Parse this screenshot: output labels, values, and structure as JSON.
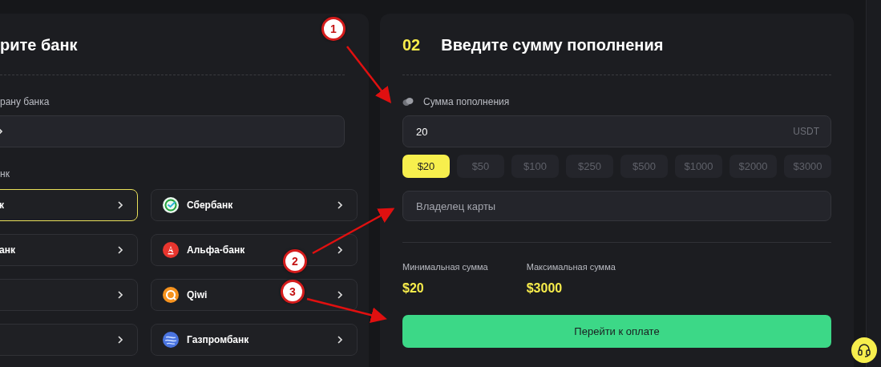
{
  "bank_panel": {
    "title": "рите банк",
    "country_label": "рану банка",
    "bank_label": "нк",
    "banks_column_1": [
      {
        "name": "к",
        "selected": true
      },
      {
        "name": "анк",
        "selected": false
      },
      {
        "selected": false
      },
      {
        "selected": false
      }
    ],
    "banks_column_2": [
      {
        "name": "Сбербанк",
        "kind": "sber",
        "selected": false
      },
      {
        "name": "Альфа-банк",
        "kind": "alfa",
        "selected": false
      },
      {
        "name": "Qiwi",
        "kind": "qiwi",
        "selected": false
      },
      {
        "name": "Газпромбанк",
        "kind": "gazprom",
        "selected": false
      }
    ]
  },
  "amount_panel": {
    "step": "02",
    "title": "Введите сумму пополнения",
    "amount_label": "Сумма пополнения",
    "amount_value": "20",
    "currency": "USDT",
    "presets": [
      {
        "label": "$20",
        "selected": true
      },
      {
        "label": "$50",
        "selected": false
      },
      {
        "label": "$100",
        "selected": false
      },
      {
        "label": "$250",
        "selected": false
      },
      {
        "label": "$500",
        "selected": false
      },
      {
        "label": "$1000",
        "selected": false
      },
      {
        "label": "$2000",
        "selected": false
      },
      {
        "label": "$3000",
        "selected": false
      }
    ],
    "owner_placeholder": "Владелец карты",
    "limits": [
      {
        "label": "Минимальная сумма",
        "value": "$20"
      },
      {
        "label": "Максимальная сумма",
        "value": "$3000"
      }
    ],
    "pay_button": "Перейти к оплате"
  },
  "callouts": [
    {
      "label": "1"
    },
    {
      "label": "2"
    },
    {
      "label": "3"
    }
  ]
}
